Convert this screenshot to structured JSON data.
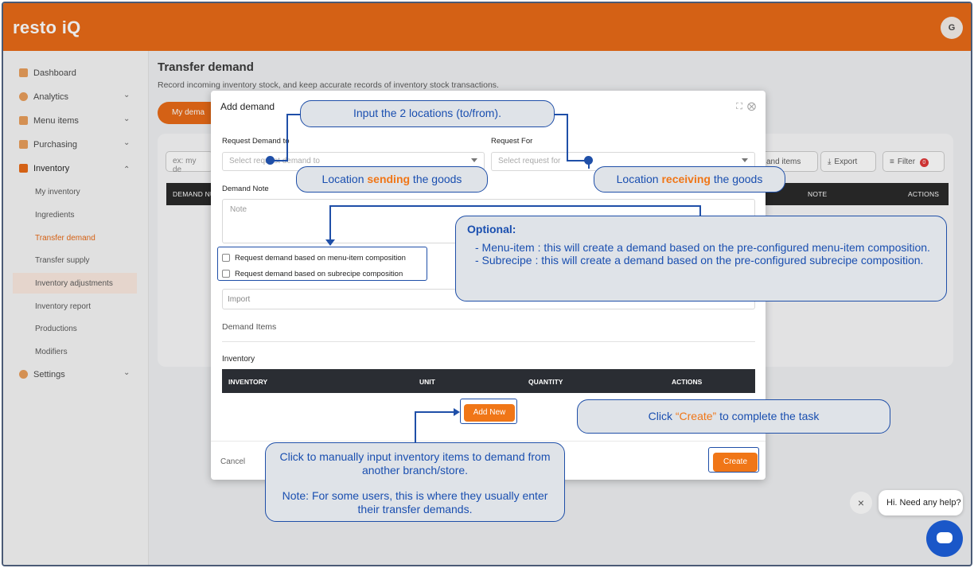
{
  "app": {
    "logo": "resto iQ",
    "avatar_initial": "G"
  },
  "sidebar": {
    "items": [
      {
        "label": "Dashboard",
        "icon": "grid-icon",
        "has_chevron": false
      },
      {
        "label": "Analytics",
        "icon": "pie-chart-icon",
        "has_chevron": true
      },
      {
        "label": "Menu items",
        "icon": "menu-book-icon",
        "has_chevron": true
      },
      {
        "label": "Purchasing",
        "icon": "cart-icon",
        "has_chevron": true
      },
      {
        "label": "Inventory",
        "icon": "inventory-icon",
        "has_chevron": true,
        "expanded": true
      },
      {
        "label": "Settings",
        "icon": "gear-icon",
        "has_chevron": true
      }
    ],
    "inventory_sub": [
      "My inventory",
      "Ingredients",
      "Transfer demand",
      "Transfer supply",
      "Inventory adjustments",
      "Inventory report",
      "Productions",
      "Modifiers"
    ],
    "active_sub": "Transfer demand"
  },
  "page": {
    "title": "Transfer demand",
    "subtitle": "Record incoming inventory stock, and keep accurate records of inventory stock transactions.",
    "tab_label": "My dema",
    "search_placeholder": "ex: my de",
    "actions": {
      "items_btn": "and items",
      "export_btn": "Export",
      "filter_btn": "Filter",
      "filter_count": "0"
    },
    "table_headers": [
      "DEMAND NU",
      "NOTE",
      "ACTIONS"
    ]
  },
  "modal": {
    "title": "Add demand",
    "request_to_label": "Request Demand to",
    "request_to_placeholder": "Select request demand to",
    "request_for_label": "Request For",
    "request_for_placeholder": "Select request for",
    "note_label": "Demand Note",
    "note_placeholder": "Note",
    "check_menu_item": "Request demand based on menu-item composition",
    "check_subrecipe": "Request demand based on subrecipe composition",
    "import_placeholder": "Import",
    "demand_items_label": "Demand Items",
    "inventory_label": "Inventory",
    "inventory_headers": [
      "INVENTORY",
      "UNIT",
      "QUANTITY",
      "ACTIONS"
    ],
    "add_new_label": "Add New",
    "cancel_label": "Cancel",
    "create_label": "Create"
  },
  "callouts": {
    "locations": "Input the 2 locations (to/from).",
    "sending_pre": "Location ",
    "sending_hl": "sending",
    "sending_post": " the goods",
    "receiving_pre": "Location ",
    "receiving_hl": "receiving",
    "receiving_post": " the goods",
    "optional_title": "Optional:",
    "optional_line1": "- Menu-item : this will create a demand based on the pre-configured menu-item composition.",
    "optional_line2": "- Subrecipe : this will create a demand based on the pre-configured subrecipe composition.",
    "create_pre": "Click ",
    "create_hl": "“Create”",
    "create_post": " to complete the task",
    "manual_line1": "Click to manually input inventory items to demand from another branch/store.",
    "manual_line2": "Note: For some users, this is where they usually enter their transfer demands."
  },
  "chat": {
    "bubble": "Hi. Need any help?",
    "close_glyph": "×"
  },
  "colors": {
    "brand": "#e8650e",
    "callout_border": "#1f4fa8",
    "callout_text": "#1a4fb0",
    "highlight": "#f07617"
  }
}
